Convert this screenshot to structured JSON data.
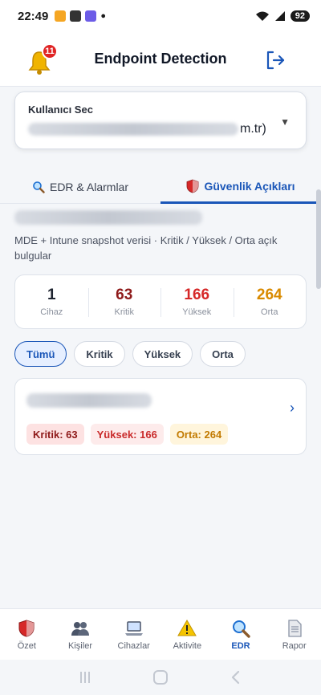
{
  "status_bar": {
    "time": "22:49",
    "battery": "92"
  },
  "header": {
    "title": "Endpoint Detection",
    "notification_count": "11"
  },
  "user_select": {
    "label": "Kullanıcı Sec",
    "value_suffix": "m.tr)"
  },
  "tabs": [
    {
      "label": "EDR & Alarmlar",
      "icon": "magnifier-icon"
    },
    {
      "label": "Güvenlik Açıkları",
      "icon": "shield-icon"
    }
  ],
  "main": {
    "subtitle": "MDE + Intune snapshot verisi · Kritik / Yüksek / Orta açık bulgular"
  },
  "stats": [
    {
      "value": "1",
      "label": "Cihaz",
      "color": "#1e2430"
    },
    {
      "value": "63",
      "label": "Kritik",
      "color": "#8e1a1a"
    },
    {
      "value": "166",
      "label": "Yüksek",
      "color": "#d62828"
    },
    {
      "value": "264",
      "label": "Orta",
      "color": "#d98a00"
    }
  ],
  "filters": [
    {
      "label": "Tümü",
      "active": true
    },
    {
      "label": "Kritik",
      "active": false
    },
    {
      "label": "Yüksek",
      "active": false
    },
    {
      "label": "Orta",
      "active": false
    }
  ],
  "device_card": {
    "pills": [
      {
        "label": "Kritik: 63"
      },
      {
        "label": "Yüksek: 166"
      },
      {
        "label": "Orta: 264"
      }
    ]
  },
  "bottom_nav": [
    {
      "label": "Özet",
      "icon": "shield-icon"
    },
    {
      "label": "Kişiler",
      "icon": "people-icon"
    },
    {
      "label": "Cihazlar",
      "icon": "laptop-icon"
    },
    {
      "label": "Aktivite",
      "icon": "warning-icon"
    },
    {
      "label": "EDR",
      "icon": "magnifier-icon",
      "active": true
    },
    {
      "label": "Rapor",
      "icon": "document-icon"
    }
  ],
  "colors": {
    "accent": "#1a56b8",
    "alert_red": "#e02424"
  }
}
